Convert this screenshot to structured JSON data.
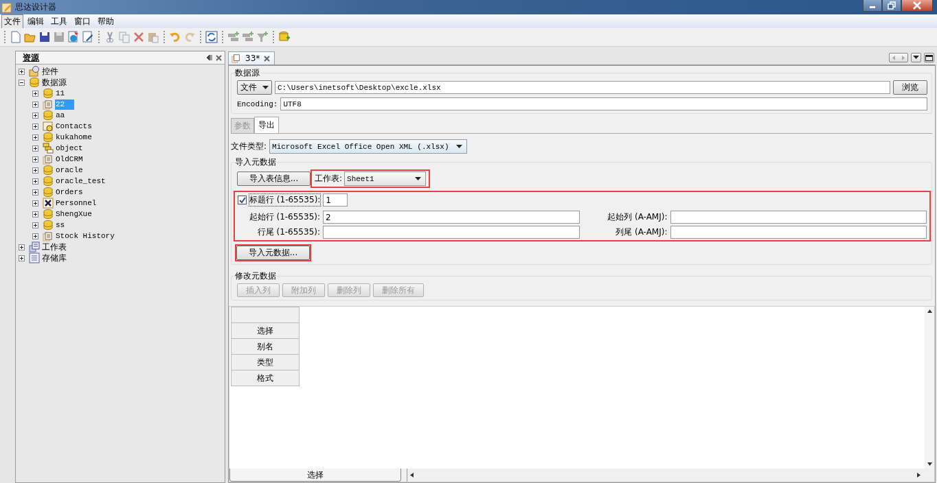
{
  "window": {
    "title": "思达设计器"
  },
  "menu": [
    {
      "label": "文件",
      "selected": true
    },
    {
      "label": "编辑",
      "selected": false
    },
    {
      "label": "工具",
      "selected": false
    },
    {
      "label": "窗口",
      "selected": false
    },
    {
      "label": "帮助",
      "selected": false
    }
  ],
  "resources_panel": {
    "title": "资源",
    "tree": [
      {
        "label": "控件",
        "kind": "component",
        "expanded": false,
        "selected": false
      },
      {
        "label": "数据源",
        "kind": "database",
        "expanded": true,
        "selected": false,
        "children": [
          {
            "label": "11",
            "kind": "database",
            "expanded": false,
            "selected": false
          },
          {
            "label": "22",
            "kind": "document",
            "expanded": false,
            "selected": true
          },
          {
            "label": "aa",
            "kind": "database",
            "expanded": false,
            "selected": false
          },
          {
            "label": "Contacts",
            "kind": "contacts",
            "expanded": false,
            "selected": false
          },
          {
            "label": "kukahome",
            "kind": "database",
            "expanded": false,
            "selected": false
          },
          {
            "label": "object",
            "kind": "object",
            "expanded": false,
            "selected": false
          },
          {
            "label": "OldCRM",
            "kind": "document",
            "expanded": false,
            "selected": false
          },
          {
            "label": "oracle",
            "kind": "database",
            "expanded": false,
            "selected": false
          },
          {
            "label": "oracle_test",
            "kind": "database",
            "expanded": false,
            "selected": false
          },
          {
            "label": "Orders",
            "kind": "database",
            "expanded": false,
            "selected": false
          },
          {
            "label": "Personnel",
            "kind": "excel",
            "expanded": false,
            "selected": false
          },
          {
            "label": "ShengXue",
            "kind": "database",
            "expanded": false,
            "selected": false
          },
          {
            "label": "ss",
            "kind": "database",
            "expanded": false,
            "selected": false
          },
          {
            "label": "Stock History",
            "kind": "document",
            "expanded": false,
            "selected": false
          }
        ]
      },
      {
        "label": "工作表",
        "kind": "worksheet",
        "expanded": false,
        "selected": false
      },
      {
        "label": "存储库",
        "kind": "storage",
        "expanded": false,
        "selected": false
      }
    ]
  },
  "editor_tab": {
    "label": "33*"
  },
  "data_source": {
    "title": "数据源",
    "source_type": "文件",
    "path": "C:\\Users\\inetsoft\\Desktop\\excle.xlsx",
    "browse": "浏览",
    "encoding_label": "Encoding:",
    "encoding": "UTF8"
  },
  "tabs": [
    {
      "label": "参数",
      "selected": false,
      "disabled": true
    },
    {
      "label": "导出",
      "selected": true,
      "disabled": false
    }
  ],
  "file_type": {
    "label": "文件类型:",
    "value": "Microsoft Excel Office Open XML (.xlsx)"
  },
  "import_metadata": {
    "title": "导入元数据",
    "import_table_info": "导入表信息...",
    "sheet_label": "工作表:",
    "sheet": "Sheet1",
    "header_row": {
      "label": "标题行 (1-65535):",
      "checked": true,
      "value": "1"
    },
    "fields": [
      {
        "label": "起始行 (1-65535):",
        "value": "2"
      },
      {
        "label": "起始列 (A-AMJ):"
      },
      {
        "label": "行尾 (1-65535):"
      },
      {
        "label": "列尾 (A-AMJ):"
      }
    ],
    "import_button": "导入元数据..."
  },
  "modify_metadata": {
    "title": "修改元数据",
    "buttons": [
      {
        "label": "插入列",
        "disabled": true
      },
      {
        "label": "附加列",
        "disabled": true
      },
      {
        "label": "删除列",
        "disabled": true
      },
      {
        "label": "删除所有",
        "disabled": true
      }
    ]
  },
  "grid": {
    "row_headers": [
      "选择",
      "别名",
      "类型",
      "格式"
    ]
  },
  "bottom_tab": {
    "label": "选择"
  }
}
